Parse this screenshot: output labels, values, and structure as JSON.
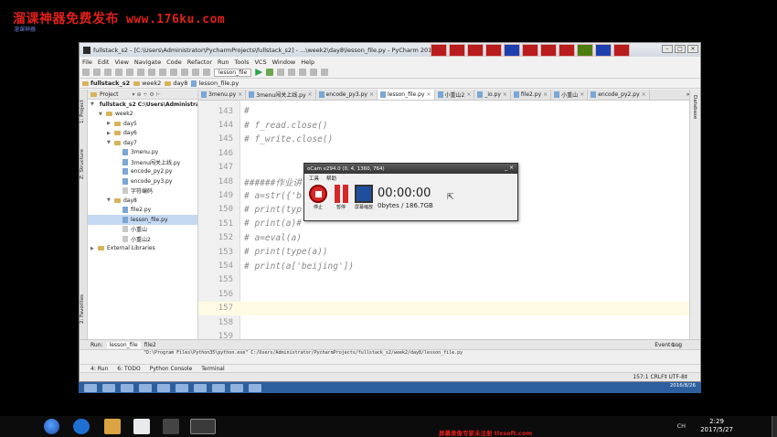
{
  "watermark": {
    "title": "溜课神器免费发布",
    "url": "www.176ku.com",
    "sub": "溜课神器"
  },
  "ide": {
    "window_title": "fullstack_s2 - [C:\\Users\\Administrator\\PycharmProjects\\fullstack_s2] - ...\\week2\\day8\\lesson_file.py - PyCharm 2016.2.1",
    "menu": [
      "File",
      "Edit",
      "View",
      "Navigate",
      "Code",
      "Refactor",
      "Run",
      "Tools",
      "VCS",
      "Window",
      "Help"
    ],
    "run_config": "lesson_file",
    "breadcrumbs": [
      "fullstack_s2",
      "week2",
      "day8",
      "lesson_file.py"
    ],
    "project_header": "Project",
    "project_tree": [
      {
        "label": "fullstack_s2  C:\\Users\\Administrator",
        "indent": 0,
        "kind": "folder",
        "arrow": "▼"
      },
      {
        "label": "week2",
        "indent": 1,
        "kind": "folder",
        "arrow": "▼"
      },
      {
        "label": "day5",
        "indent": 2,
        "kind": "folder",
        "arrow": "▶"
      },
      {
        "label": "day6",
        "indent": 2,
        "kind": "folder",
        "arrow": "▶"
      },
      {
        "label": "day7",
        "indent": 2,
        "kind": "folder",
        "arrow": "▼"
      },
      {
        "label": "3menu.py",
        "indent": 3,
        "kind": "py",
        "arrow": ""
      },
      {
        "label": "3menu闯关上线.py",
        "indent": 3,
        "kind": "py",
        "arrow": ""
      },
      {
        "label": "encode_py2.py",
        "indent": 3,
        "kind": "py",
        "arrow": ""
      },
      {
        "label": "encode_py3.py",
        "indent": 3,
        "kind": "py",
        "arrow": ""
      },
      {
        "label": "字符编码",
        "indent": 3,
        "kind": "file",
        "arrow": ""
      },
      {
        "label": "day8",
        "indent": 2,
        "kind": "folder",
        "arrow": "▼"
      },
      {
        "label": "file2.py",
        "indent": 3,
        "kind": "py",
        "arrow": ""
      },
      {
        "label": "lesson_file.py",
        "indent": 3,
        "kind": "py",
        "arrow": "",
        "selected": true
      },
      {
        "label": "小重山",
        "indent": 3,
        "kind": "file",
        "arrow": ""
      },
      {
        "label": "小重山2",
        "indent": 3,
        "kind": "file",
        "arrow": ""
      },
      {
        "label": "External Libraries",
        "indent": 0,
        "kind": "lib",
        "arrow": "▶"
      }
    ],
    "tabs": [
      {
        "label": "3menu.py"
      },
      {
        "label": "3menu闯关上线.py"
      },
      {
        "label": "encode_py3.py"
      },
      {
        "label": "lesson_file.py",
        "active": true
      },
      {
        "label": "小重山2"
      },
      {
        "label": "_io.py"
      },
      {
        "label": "file2.py"
      },
      {
        "label": "小重山"
      },
      {
        "label": "encode_py2.py"
      }
    ],
    "tab_overflow": "»81",
    "code_lines": [
      {
        "num": "143",
        "text": "#"
      },
      {
        "num": "144",
        "text": "# f_read.close()"
      },
      {
        "num": "145",
        "text": "# f_write.close()"
      },
      {
        "num": "146",
        "text": ""
      },
      {
        "num": "147",
        "text": ""
      },
      {
        "num": "148",
        "text": "######作业讲"
      },
      {
        "num": "149",
        "text": "# a=str({'b"
      },
      {
        "num": "150",
        "text": "# print(typ"
      },
      {
        "num": "151",
        "text": "# print(a)#"
      },
      {
        "num": "152",
        "text": "# a=eval(a)"
      },
      {
        "num": "153",
        "text": "# print(type(a))"
      },
      {
        "num": "154",
        "text": "# print(a['beijing'])"
      },
      {
        "num": "155",
        "text": ""
      },
      {
        "num": "156",
        "text": ""
      },
      {
        "num": "157",
        "text": "",
        "current": true
      },
      {
        "num": "158",
        "text": ""
      },
      {
        "num": "159",
        "text": ""
      }
    ],
    "right_tab": "Database",
    "left_tabs": [
      "1: Project",
      "Z: Structure",
      "2: Favorites"
    ],
    "run_tabs": [
      "Run:",
      "lesson_file",
      "file2"
    ],
    "console_text": "\"D:\\Program Files\\Python35\\python.exe\" C:/Users/Administrator/PycharmProjects/fullstack_s2/week2/day8/lesson_file.py",
    "tool_windows": [
      "4: Run",
      "6: TODO",
      "Python Console",
      "Terminal"
    ],
    "event_log": "Event Log",
    "status_position": "157:1  CRLF‡  UTF-8‡",
    "vm_date": "2016/8/26"
  },
  "ocam": {
    "title": "oCam v294.0 (0, 4, 1360, 764)",
    "menu": [
      "工具",
      "帮助"
    ],
    "buttons": [
      "停止",
      "暂停",
      "屏幕缩放"
    ],
    "timer": "00:00:00",
    "size": "0bytes / 186.7GB"
  },
  "host_taskbar": {
    "ad": "屏幕录像专家未注册 tlxsoft.com",
    "tray": "CH",
    "time": "2:29",
    "date": "2017/5/27"
  }
}
